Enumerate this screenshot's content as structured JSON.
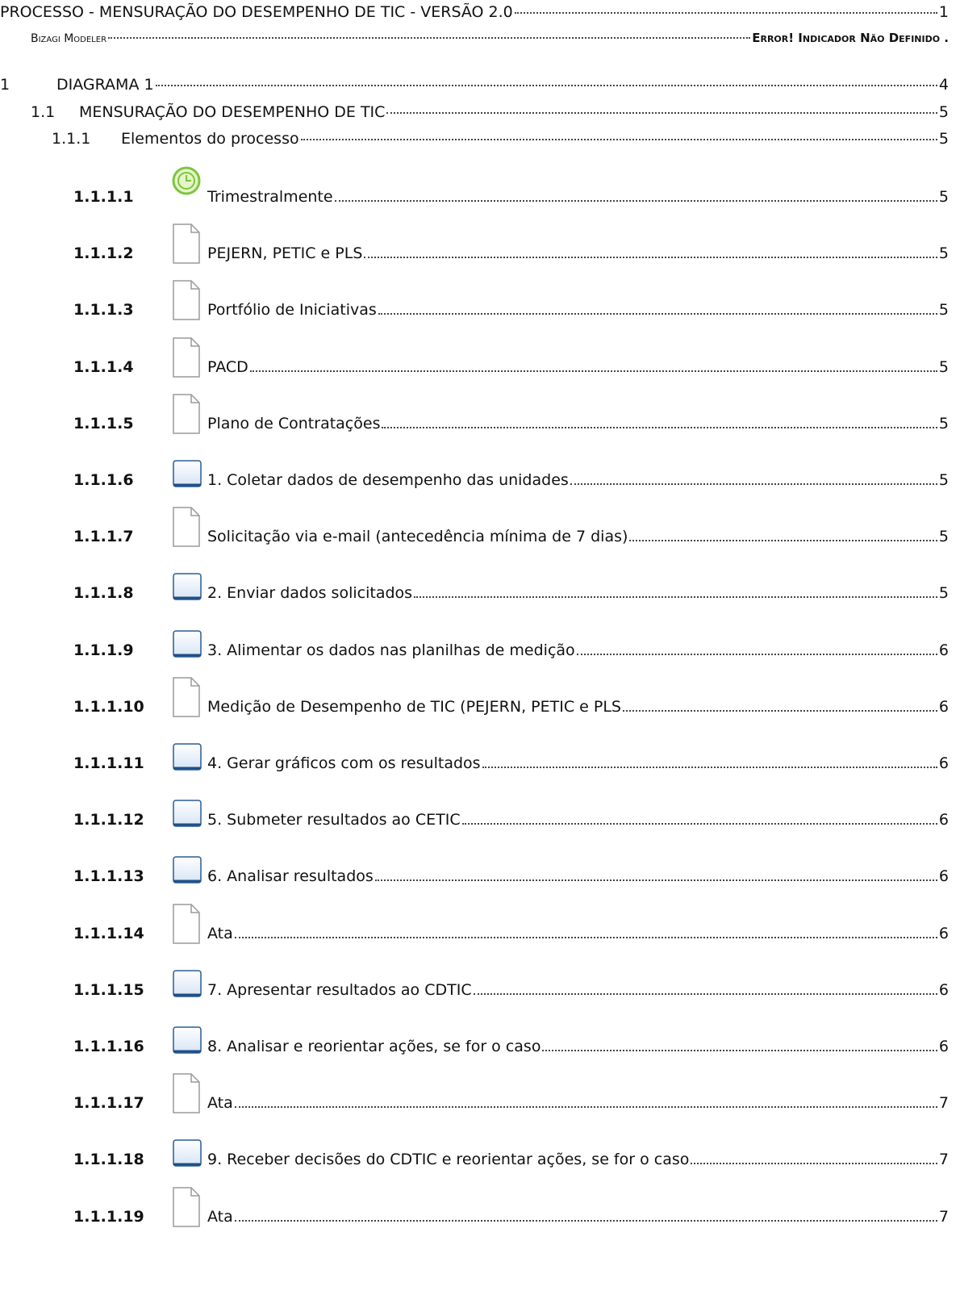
{
  "toc": {
    "heading": {
      "title": "PROCESSO - MENSURAÇÃO DO DESEMPENHO DE TIC - VERSÃO 2.0",
      "page": "1"
    },
    "modeler": {
      "title": "Bizagi Modeler",
      "page": "Error! Indicador Não Definido ."
    },
    "diagram": {
      "num": "1",
      "title": "DIAGRAMA 1",
      "page": "4"
    },
    "process": {
      "num": "1.1",
      "title": "MENSURAÇÃO DO DESEMPENHO DE TIC",
      "page": "5"
    },
    "elements": {
      "num": "1.1.1",
      "title": "Elementos do processo",
      "page": "5"
    },
    "items": [
      {
        "num": "1.1.1.1",
        "icon": "timer-event-icon",
        "title": "Trimestralmente",
        "page": "5"
      },
      {
        "num": "1.1.1.2",
        "icon": "document-icon",
        "title": "PEJERN, PETIC e PLS",
        "page": "5"
      },
      {
        "num": "1.1.1.3",
        "icon": "document-icon",
        "title": "Portfólio de Iniciativas",
        "page": "5"
      },
      {
        "num": "1.1.1.4",
        "icon": "document-icon",
        "title": "PACD",
        "page": "5"
      },
      {
        "num": "1.1.1.5",
        "icon": "document-icon",
        "title": "Plano de Contratações",
        "page": "5"
      },
      {
        "num": "1.1.1.6",
        "icon": "task-icon",
        "title": "1. Coletar dados de desempenho das unidades",
        "page": "5"
      },
      {
        "num": "1.1.1.7",
        "icon": "document-icon",
        "title": "Solicitação via e-mail (antecedência mínima de 7 dias)",
        "page": "5"
      },
      {
        "num": "1.1.1.8",
        "icon": "task-icon",
        "title": "2. Enviar dados solicitados",
        "page": "5"
      },
      {
        "num": "1.1.1.9",
        "icon": "task-icon",
        "title": "3. Alimentar os dados nas planilhas de medição",
        "page": "6"
      },
      {
        "num": "1.1.1.10",
        "icon": "document-icon",
        "title": "Medição de Desempenho de TIC (PEJERN, PETIC e PLS",
        "page": "6"
      },
      {
        "num": "1.1.1.11",
        "icon": "task-icon",
        "title": "4. Gerar gráficos com os resultados",
        "page": "6"
      },
      {
        "num": "1.1.1.12",
        "icon": "task-icon",
        "title": "5. Submeter resultados ao CETIC",
        "page": "6"
      },
      {
        "num": "1.1.1.13",
        "icon": "task-icon",
        "title": "6. Analisar resultados",
        "page": "6"
      },
      {
        "num": "1.1.1.14",
        "icon": "document-icon",
        "title": "Ata",
        "page": "6"
      },
      {
        "num": "1.1.1.15",
        "icon": "task-icon",
        "title": "7. Apresentar resultados ao CDTIC",
        "page": "6"
      },
      {
        "num": "1.1.1.16",
        "icon": "task-icon",
        "title": "8. Analisar e reorientar ações, se for o caso",
        "page": "6"
      },
      {
        "num": "1.1.1.17",
        "icon": "document-icon",
        "title": "Ata",
        "page": "7"
      },
      {
        "num": "1.1.1.18",
        "icon": "task-icon",
        "title": "9. Receber decisões do CDTIC e reorientar ações, se for o caso",
        "page": "7"
      },
      {
        "num": "1.1.1.19",
        "icon": "document-icon",
        "title": "Ata",
        "page": "7"
      }
    ]
  }
}
